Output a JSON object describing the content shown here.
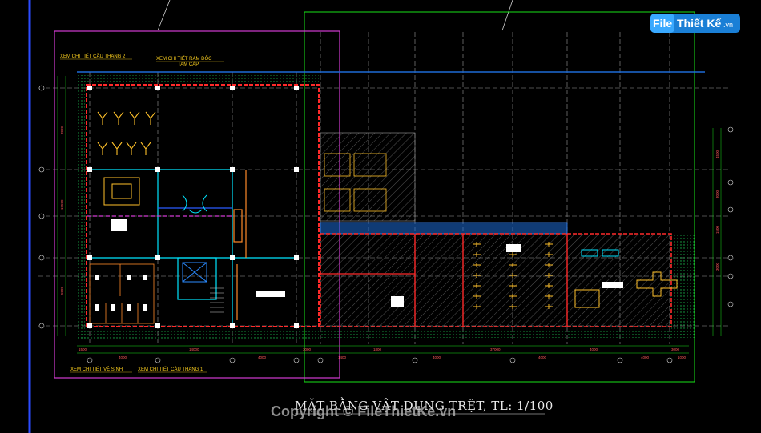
{
  "logo": {
    "brand": "File",
    "brand2": "Thiết Kế",
    "domain": ".vn"
  },
  "notes": {
    "stair2": "XEM CHI TIẾT CẦU THANG 2",
    "ramp_line1": "XEM CHI TIẾT RAM DỐC",
    "ramp_line2": "TAM CẤP",
    "wc": "XEM CHI TIẾT VỆ SINH",
    "stair1": "XEM CHI TIẾT CẦU THANG 1"
  },
  "drawing_title": "MẶT BẰNG VẬT DỤNG TRỆT, TL: 1/100",
  "watermark": "Copyright © FileThietKe.vn",
  "dimensions_bottom": [
    "1500",
    "4000",
    "14000",
    "4000",
    "3000",
    "1400",
    "1800",
    "4000",
    "37000",
    "4000",
    "4000",
    "4000",
    "3000",
    "1000"
  ],
  "dimensions_left": [
    "3000",
    "19500",
    "5000"
  ],
  "dimensions_right": [
    "4500",
    "3000",
    "1500",
    "3000"
  ],
  "colors": {
    "background": "#000000",
    "wall_red": "#ff2a2a",
    "cyan": "#00e5ff",
    "yellow": "#ffd21f",
    "green_frame": "#19e219",
    "magenta_frame": "#d23bd2",
    "hatch": "#8a8a8a",
    "blue_band": "#1e6bd6",
    "grid": "#9c9c9c"
  }
}
